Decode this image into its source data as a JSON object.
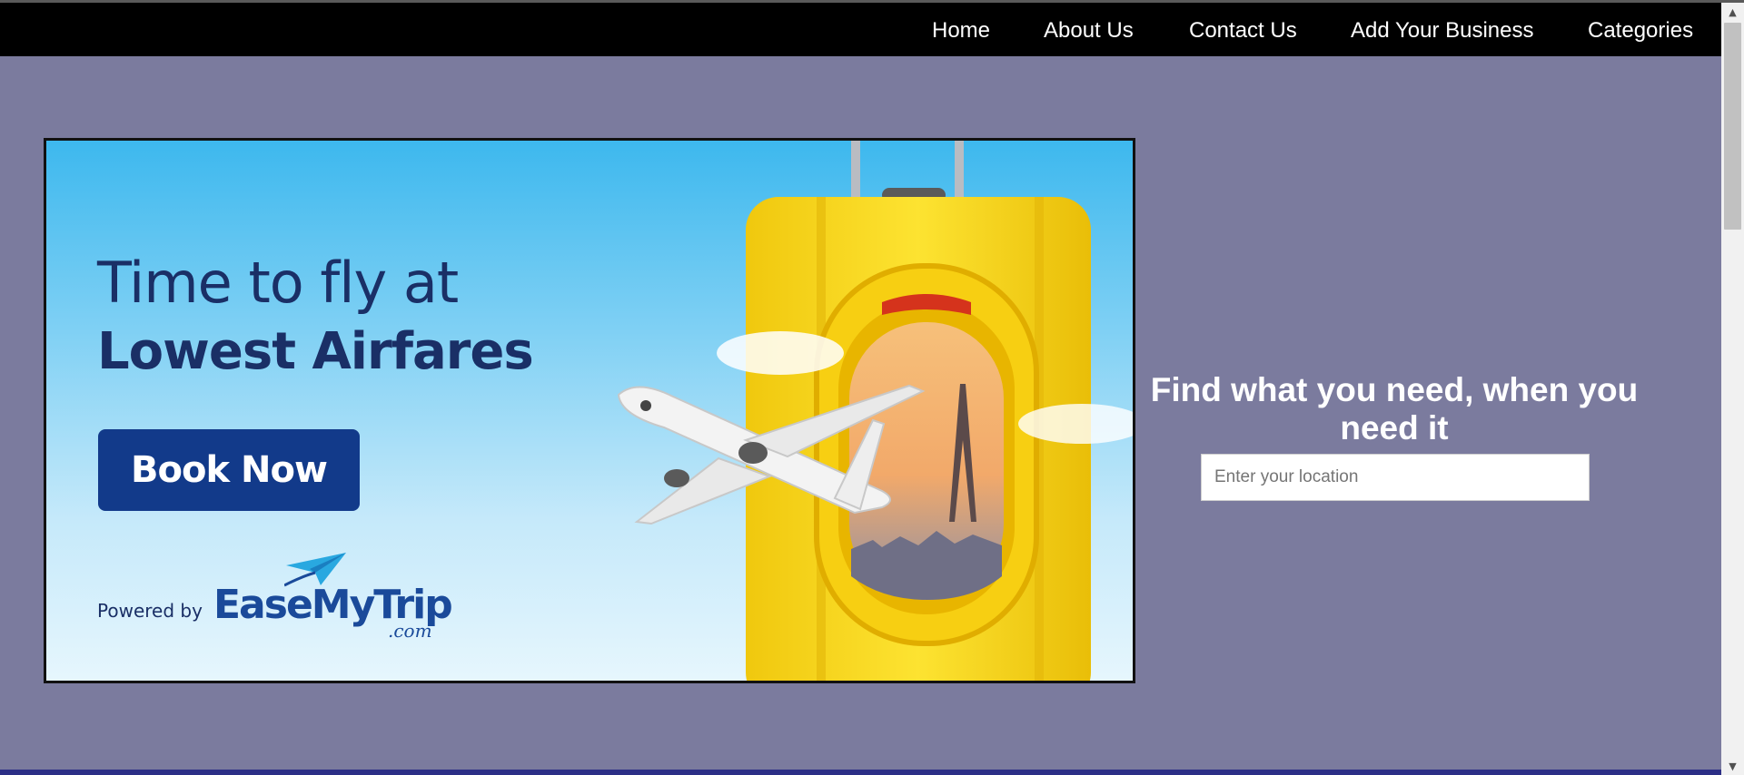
{
  "nav": {
    "links": [
      {
        "label": "Home"
      },
      {
        "label": "About Us"
      },
      {
        "label": "Contact Us"
      },
      {
        "label": "Add Your Business"
      },
      {
        "label": "Categories"
      }
    ]
  },
  "banner": {
    "headline_line1": "Time to fly at",
    "headline_line2": "Lowest Airfares",
    "button_label": "Book Now",
    "powered_by": "Powered by",
    "brand_name": "EaseMyTrip",
    "brand_suffix": ".com"
  },
  "hero": {
    "title": "Find what you need, when you need it",
    "location_placeholder": "Enter your location",
    "location_value": ""
  },
  "colors": {
    "page_background": "#7b7b9e",
    "navbar_background": "#000000",
    "nav_text": "#ffffff",
    "banner_button": "#123a8a",
    "suitcase": "#f5d417"
  },
  "icons": {
    "scroll_up": "scroll-up-arrow-icon",
    "scroll_down": "scroll-down-arrow-icon",
    "brand_plane": "paper-plane-icon",
    "airplane": "airplane-icon"
  }
}
